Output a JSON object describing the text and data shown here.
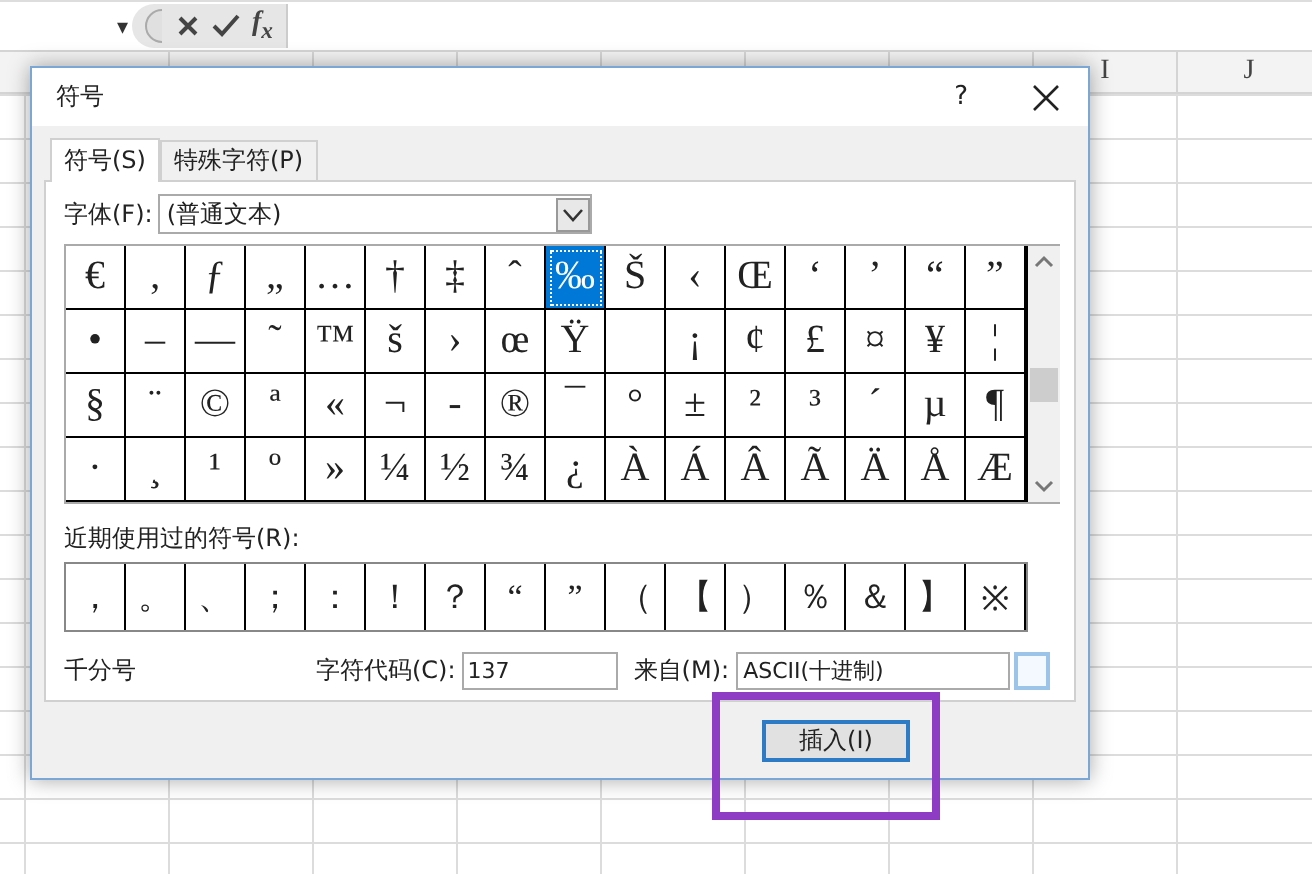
{
  "formula_bar": {
    "name_box_caret": "▾",
    "function_label": "f$_{x}$"
  },
  "sheet": {
    "visible_columns": [
      "I",
      "J"
    ]
  },
  "dialog": {
    "title": "符号",
    "help": "?",
    "tabs": [
      {
        "label": "符号(S)",
        "selected": true
      },
      {
        "label": "特殊字符(P)",
        "selected": false
      }
    ],
    "font": {
      "label": "字体(F):",
      "value": "(普通文本)"
    },
    "symbols": [
      [
        {
          "char": "€",
          "selected": false
        },
        {
          "char": "‚",
          "selected": false
        },
        {
          "char": "ƒ",
          "selected": false
        },
        {
          "char": "„",
          "selected": false
        },
        {
          "char": "…",
          "selected": false
        },
        {
          "char": "†",
          "selected": false
        },
        {
          "char": "‡",
          "selected": false
        },
        {
          "char": "ˆ",
          "selected": false
        },
        {
          "char": "‰",
          "selected": true
        },
        {
          "char": "Š",
          "selected": false
        },
        {
          "char": "‹",
          "selected": false
        },
        {
          "char": "Œ",
          "selected": false
        },
        {
          "char": "‘",
          "selected": false
        },
        {
          "char": "’",
          "selected": false
        },
        {
          "char": "“",
          "selected": false
        },
        {
          "char": "”",
          "selected": false
        }
      ],
      [
        {
          "char": "•",
          "selected": false
        },
        {
          "char": "–",
          "selected": false
        },
        {
          "char": "—",
          "selected": false
        },
        {
          "char": "˜",
          "selected": false
        },
        {
          "char": "™",
          "selected": false
        },
        {
          "char": "š",
          "selected": false
        },
        {
          "char": "›",
          "selected": false
        },
        {
          "char": "œ",
          "selected": false
        },
        {
          "char": "Ÿ",
          "selected": false
        },
        {
          "selected": false
        },
        {
          "char": "¡",
          "selected": false
        },
        {
          "char": "¢",
          "selected": false
        },
        {
          "char": "£",
          "selected": false
        },
        {
          "char": "¤",
          "selected": false
        },
        {
          "char": "¥",
          "selected": false
        },
        {
          "char": "¦",
          "selected": false
        }
      ],
      [
        {
          "char": "§",
          "selected": false
        },
        {
          "char": "¨",
          "selected": false
        },
        {
          "char": "©",
          "selected": false
        },
        {
          "char": "ª",
          "selected": false
        },
        {
          "char": "«",
          "selected": false
        },
        {
          "char": "¬",
          "selected": false
        },
        {
          "char": "-",
          "selected": false
        },
        {
          "char": "®",
          "selected": false
        },
        {
          "char": "¯",
          "selected": false
        },
        {
          "char": "°",
          "selected": false
        },
        {
          "char": "±",
          "selected": false
        },
        {
          "char": "²",
          "selected": false
        },
        {
          "char": "³",
          "selected": false
        },
        {
          "char": "´",
          "selected": false
        },
        {
          "char": "µ",
          "selected": false
        },
        {
          "char": "¶",
          "selected": false
        }
      ],
      [
        {
          "char": "·",
          "selected": false
        },
        {
          "char": "¸",
          "selected": false
        },
        {
          "char": "¹",
          "selected": false
        },
        {
          "char": "º",
          "selected": false
        },
        {
          "char": "»",
          "selected": false
        },
        {
          "char": "¼",
          "selected": false
        },
        {
          "char": "½",
          "selected": false
        },
        {
          "char": "¾",
          "selected": false
        },
        {
          "char": "¿",
          "selected": false
        },
        {
          "char": "À",
          "selected": false
        },
        {
          "char": "Á",
          "selected": false
        },
        {
          "char": "Â",
          "selected": false
        },
        {
          "char": "Ã",
          "selected": false
        },
        {
          "char": "Ä",
          "selected": false
        },
        {
          "char": "Å",
          "selected": false
        },
        {
          "char": "Æ",
          "selected": false
        }
      ]
    ],
    "recent_label": "近期使用过的符号(R):",
    "recent": [
      "，",
      "。",
      "、",
      "；",
      "：",
      "！",
      "？",
      "“",
      "”",
      "（",
      "【",
      "）",
      "％",
      "＆",
      "】",
      "※"
    ],
    "symbol_name": "千分号",
    "code_label": "字符代码(C):",
    "code_value": "137",
    "from_label": "来自(M):",
    "from_value": "ASCII(十进制)",
    "insert_button": "插入(I)"
  },
  "annotation": {
    "kind": "rectangle",
    "color": "#8e3cc4"
  }
}
